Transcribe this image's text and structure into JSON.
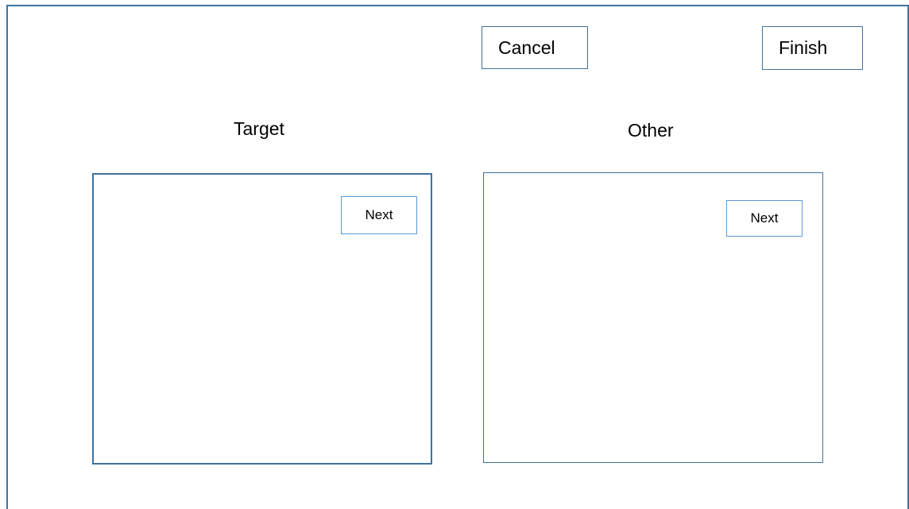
{
  "toolbar": {
    "cancel_label": "Cancel",
    "finish_label": "Finish"
  },
  "panels": [
    {
      "heading": "Target",
      "next_label": "Next"
    },
    {
      "heading": "Other",
      "next_label": "Next"
    }
  ],
  "colors": {
    "frame_border": "#41719c",
    "next_border": "#5a9bd5",
    "background": "#ffffff"
  }
}
